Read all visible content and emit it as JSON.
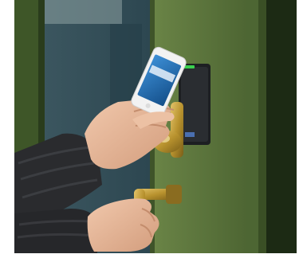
{
  "scene": {
    "subject": "hand-holding-smartphone-at-door-access-reader",
    "colors": {
      "door_green": "#5f7a3e",
      "door_green_dark": "#3f5429",
      "glass_blue": "#2f4a55",
      "sleeve": "#2a2b2e",
      "skin": "#e7b99a",
      "brass": "#b8922e",
      "reader": "#1d1f22",
      "reader_led": "#3ad04f",
      "phone_body": "#f2f2f2",
      "phone_screen": "#1d6fb8"
    }
  }
}
